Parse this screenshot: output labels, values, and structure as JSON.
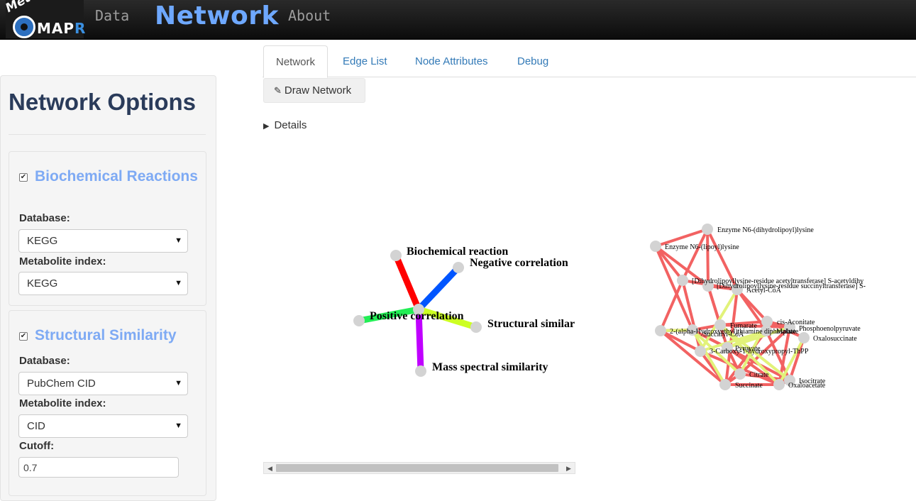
{
  "navbar": {
    "logo": {
      "text_meta": "Meta",
      "text_mapr": "MAP",
      "text_r": "R"
    },
    "links": [
      {
        "label": "Data"
      },
      {
        "label": "Network"
      },
      {
        "label": "About"
      }
    ]
  },
  "sidebar": {
    "title": "Network Options",
    "biochemical": {
      "checked": true,
      "title": "Biochemical Reactions",
      "database_label": "Database:",
      "database_value": "KEGG",
      "index_label": "Metabolite index:",
      "index_value": "KEGG"
    },
    "structural": {
      "checked": true,
      "title": "Structural Similarity",
      "database_label": "Database:",
      "database_value": "PubChem CID",
      "index_label": "Metabolite index:",
      "index_value": "CID",
      "cutoff_label": "Cutoff:",
      "cutoff_value": "0.7"
    }
  },
  "tabs": [
    {
      "label": "Network",
      "active": true
    },
    {
      "label": "Edge List"
    },
    {
      "label": "Node Attributes"
    },
    {
      "label": "Debug"
    }
  ],
  "draw_button": {
    "label": "Draw Network",
    "icon": "magic-wand-icon"
  },
  "details": {
    "label": "Details"
  },
  "legend": [
    {
      "label": "Biochemical reaction",
      "color": "#ff0000"
    },
    {
      "label": "Negative correlation",
      "color": "#0055ff"
    },
    {
      "label": "Positive correlation",
      "color": "#22ee55"
    },
    {
      "label": "Structural similar",
      "color": "#ccff22"
    },
    {
      "label": "Mass spectral similarity",
      "color": "#c000ff"
    }
  ],
  "network_nodes": [
    "Enzyme N6-(dihydrolipoyl)lysine",
    "Enzyme N6-(lipoyl)lysine",
    "[Dihydrolipoyllysine-residue acetyltransferase] S-acetyldihy",
    "[Dihydrolipoyllysine-residue succinyltransferase] S-",
    "Acetyl-CoA",
    "cis-Aconitate",
    "Fumarate",
    "2-(alpha-Hydroxyethyl)thiamine diphosphate",
    "Succinyl-CoA",
    "Phosphoenolpyruvate",
    "Malate",
    "Oxalosuccinate",
    "3-Carboxy-1-hydroxypropyl-ThPP",
    "Pyruvate",
    "Citrate",
    "Isocitrate",
    "Succinate",
    "Oxaloacetate"
  ],
  "colors": {
    "edge_red": "#f25a5a",
    "edge_yellow": "#e2f27a",
    "node_fill": "#d3d3d3",
    "link": "#337ab7",
    "title_blue": "#7eaaf4"
  }
}
